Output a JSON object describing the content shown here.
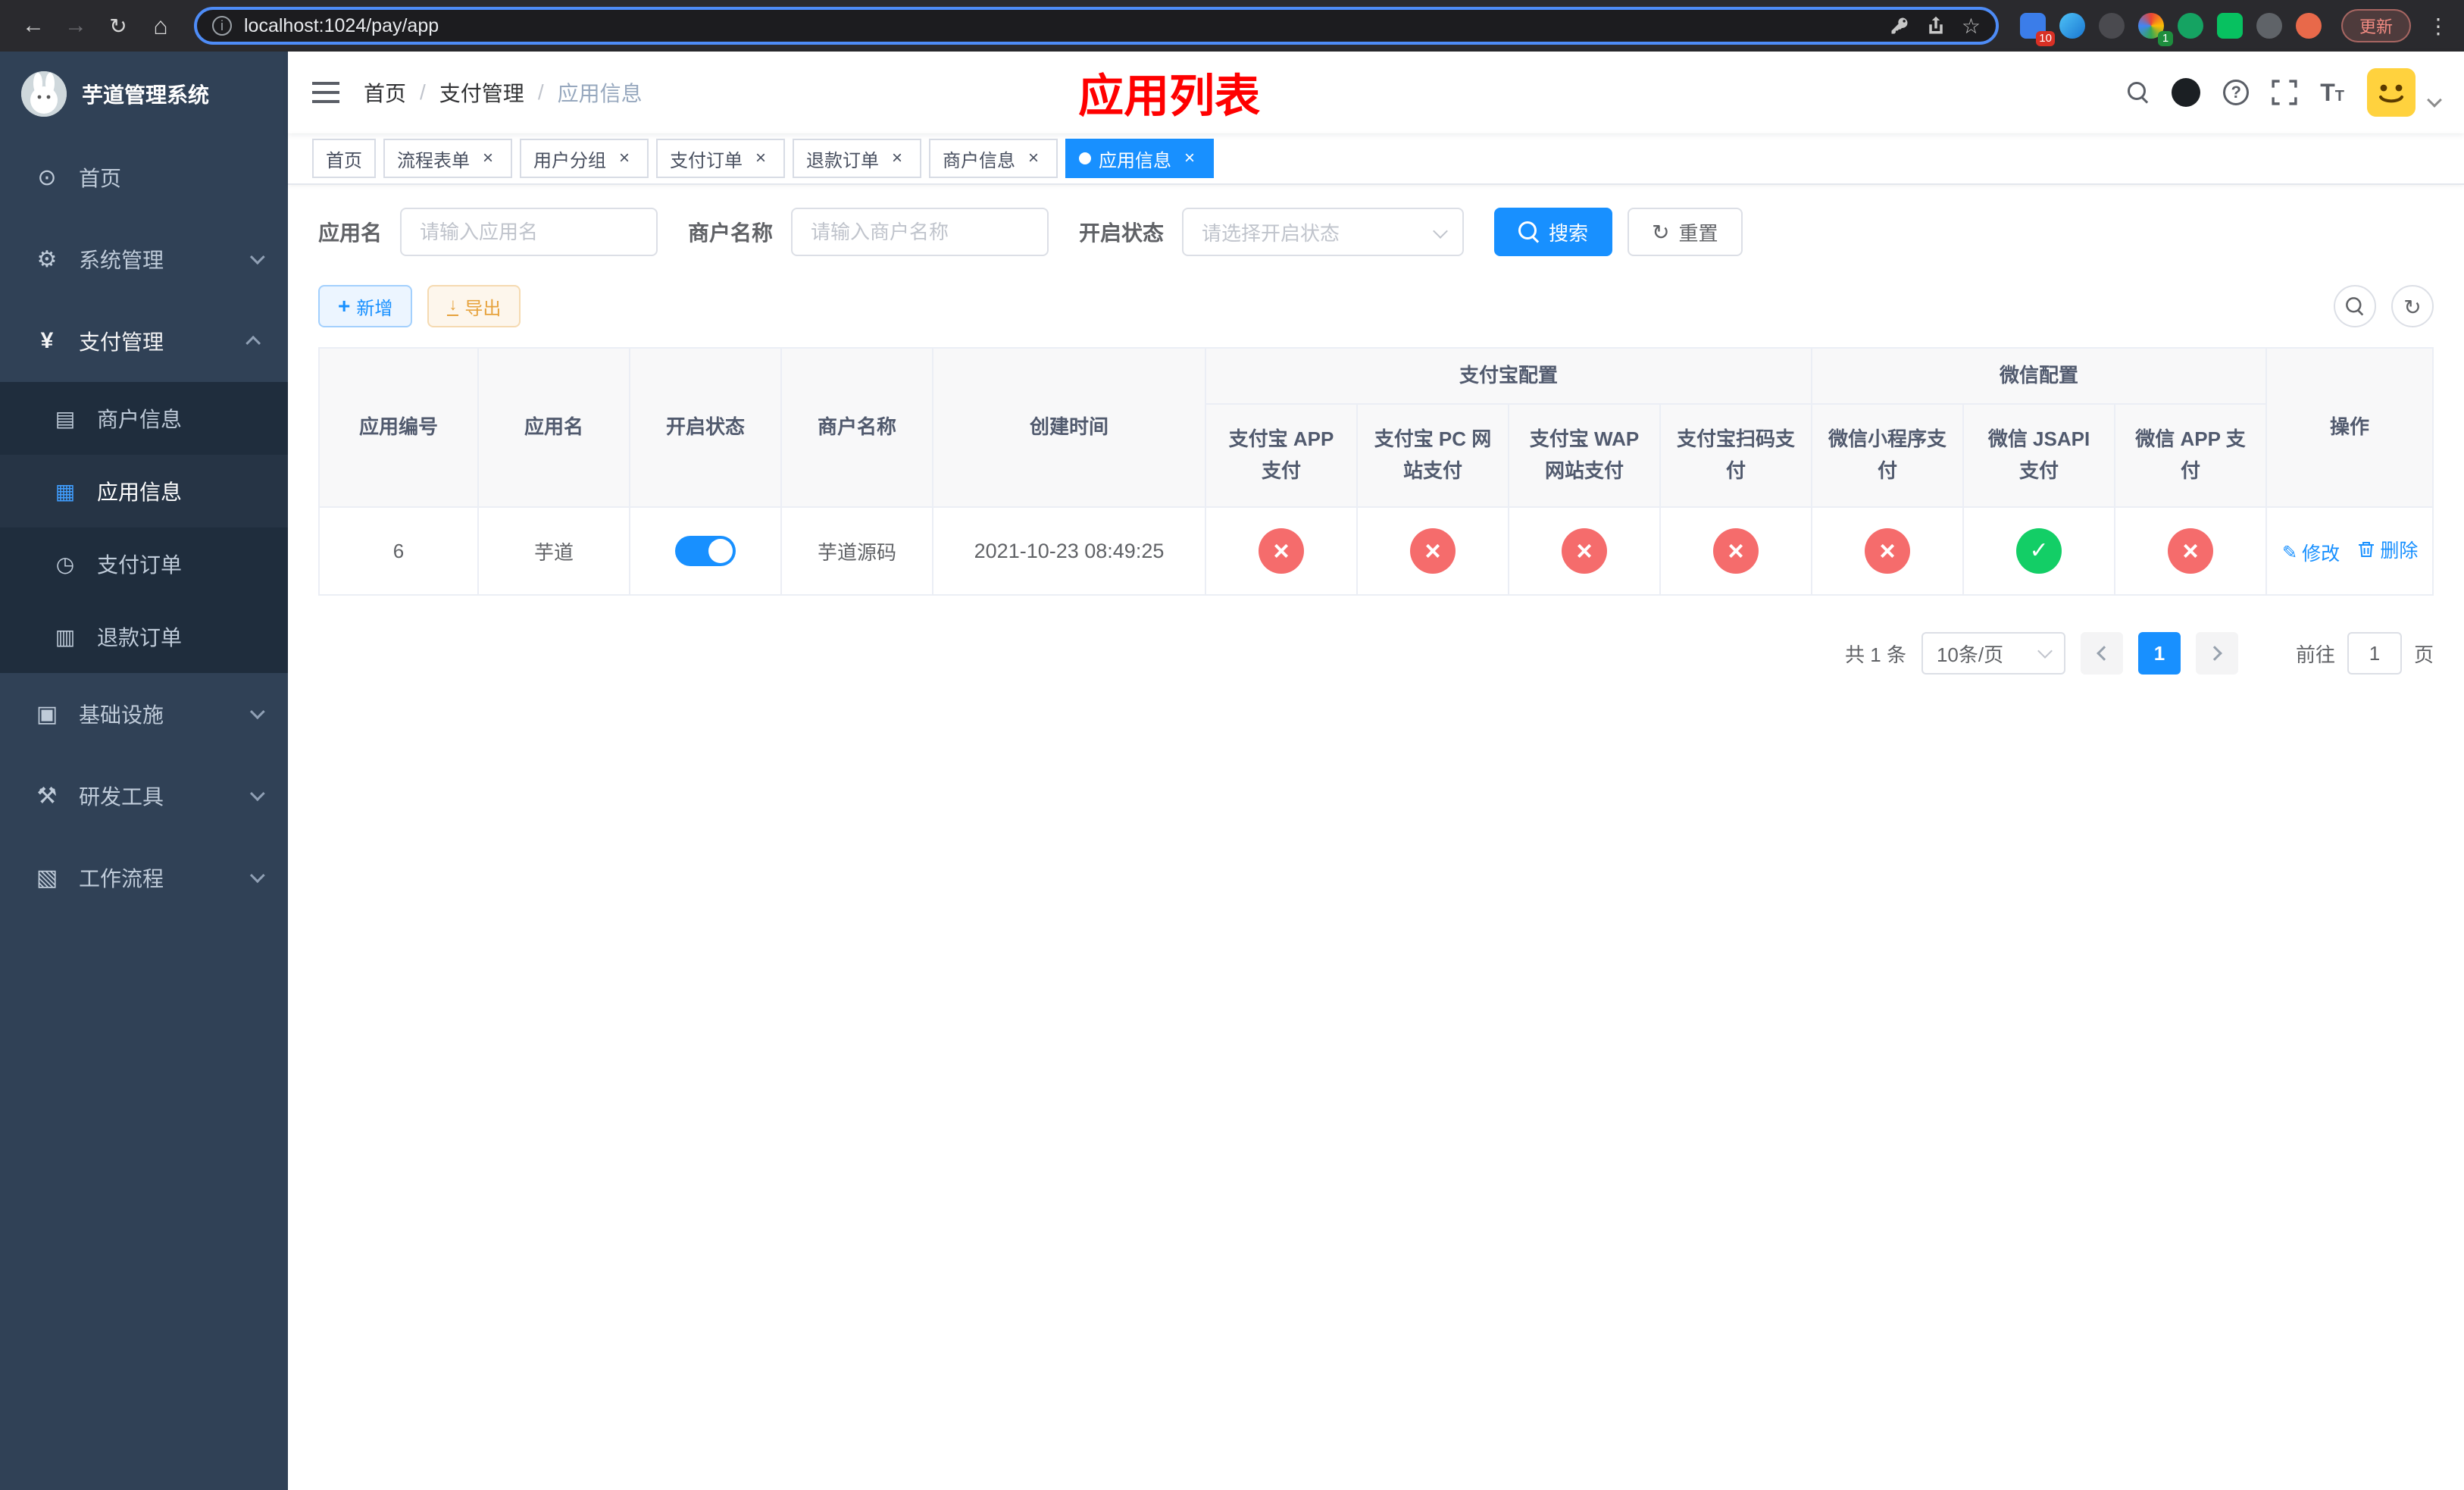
{
  "browser": {
    "url": "localhost:1024/pay/app",
    "update_label": "更新",
    "extension_badge_first": "10",
    "extension_badge_fourth": "1"
  },
  "sidebar": {
    "title": "芋道管理系统",
    "items": [
      {
        "label": "首页"
      },
      {
        "label": "系统管理"
      },
      {
        "label": "支付管理"
      },
      {
        "label": "基础设施"
      },
      {
        "label": "研发工具"
      },
      {
        "label": "工作流程"
      }
    ],
    "payment_children": [
      {
        "label": "商户信息"
      },
      {
        "label": "应用信息"
      },
      {
        "label": "支付订单"
      },
      {
        "label": "退款订单"
      }
    ]
  },
  "header": {
    "breadcrumb": [
      {
        "label": "首页"
      },
      {
        "label": "支付管理"
      },
      {
        "label": "应用信息"
      }
    ],
    "page_title": "应用列表"
  },
  "tabs": [
    {
      "label": "首页"
    },
    {
      "label": "流程表单"
    },
    {
      "label": "用户分组"
    },
    {
      "label": "支付订单"
    },
    {
      "label": "退款订单"
    },
    {
      "label": "商户信息"
    },
    {
      "label": "应用信息"
    }
  ],
  "filters": {
    "app_name": {
      "label": "应用名",
      "placeholder": "请输入应用名",
      "value": ""
    },
    "merchant_name": {
      "label": "商户名称",
      "placeholder": "请输入商户名称",
      "value": ""
    },
    "status": {
      "label": "开启状态",
      "placeholder": "请选择开启状态",
      "value": ""
    },
    "search_label": "搜索",
    "reset_label": "重置"
  },
  "toolbar": {
    "add_label": "新增",
    "export_label": "导出"
  },
  "table": {
    "groups": {
      "alipay": "支付宝配置",
      "wechat": "微信配置"
    },
    "columns": {
      "app_id": "应用编号",
      "app_name": "应用名",
      "status": "开启状态",
      "merchant": "商户名称",
      "created": "创建时间",
      "alipay_app": "支付宝 APP 支付",
      "alipay_pc": "支付宝 PC 网站支付",
      "alipay_wap": "支付宝 WAP 网站支付",
      "alipay_qr": "支付宝扫码支付",
      "wx_lite": "微信小程序支付",
      "wx_jsapi": "微信 JSAPI 支付",
      "wx_app": "微信 APP 支付",
      "actions": "操作"
    },
    "rows": [
      {
        "app_id": "6",
        "app_name": "芋道",
        "enabled": true,
        "merchant": "芋道源码",
        "created": "2021-10-23 08:49:25",
        "configs": [
          "fail",
          "fail",
          "fail",
          "fail",
          "fail",
          "ok",
          "fail"
        ],
        "edit_label": "修改",
        "delete_label": "删除"
      }
    ]
  },
  "pagination": {
    "total": "共 1 条",
    "page_size": "10条/页",
    "current_page": "1",
    "goto_label": "前往",
    "goto_value": "1",
    "unit_label": "页"
  },
  "colors": {
    "accent": "#1890ff",
    "success": "#13ce66",
    "danger": "#f56c6c",
    "title_red": "#ff0000",
    "sidebar_bg": "#304156",
    "submenu_bg": "#1f2d3d"
  }
}
